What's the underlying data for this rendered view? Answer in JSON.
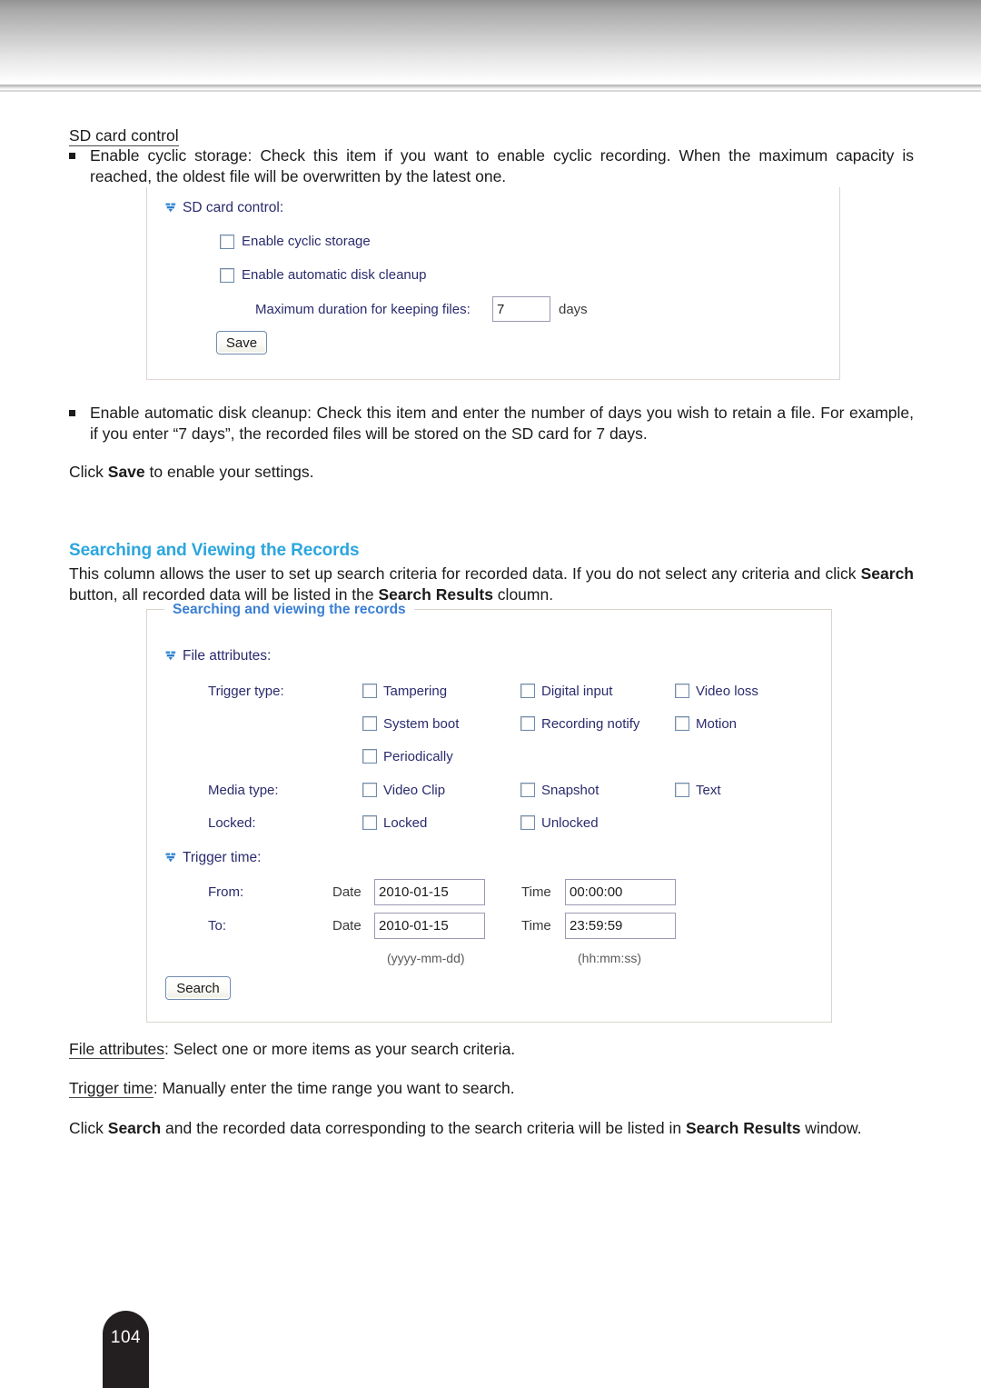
{
  "page": {
    "number": "104"
  },
  "sd_section": {
    "heading": "SD card control",
    "bullet1": "Enable cyclic storage: Check this item if you want to enable cyclic recording. When the maximum capacity is reached, the oldest file will be overwritten by the latest one.",
    "bullet2": "Enable automatic disk cleanup: Check this item and enter the number of days you wish to retain a file. For example, if you enter “7 days”, the recorded files will be stored on the SD card for 7 days.",
    "click_save_prefix": "Click ",
    "click_save_bold": "Save",
    "click_save_suffix": " to enable your settings."
  },
  "sd_panel": {
    "group_label": "SD card control:",
    "chevron_icon": "double-chevron-down-icon",
    "checkbox_cyclic": {
      "label": "Enable cyclic storage",
      "checked": false
    },
    "checkbox_cleanup": {
      "label": "Enable automatic disk cleanup",
      "checked": false
    },
    "max_duration_label": "Maximum duration for keeping files:",
    "max_duration_value": "7",
    "max_duration_unit": "days",
    "save_button": "Save"
  },
  "search_section": {
    "heading": "Searching and Viewing the Records",
    "intro_1": "This column allows the user to set up search criteria for recorded data. If you do not select any criteria ",
    "intro_2": "and click ",
    "intro_bold_1": "Search",
    "intro_3": " button, all recorded data will be listed in the ",
    "intro_bold_2": "Search Results",
    "intro_4": " cloumn."
  },
  "search_panel": {
    "legend": "Searching and viewing the records",
    "chevron_icon": "double-chevron-down-icon",
    "file_attributes_label": "File attributes:",
    "trigger_type_label": "Trigger type:",
    "trigger_type_options": [
      {
        "label": "Tampering",
        "checked": false
      },
      {
        "label": "Digital input",
        "checked": false
      },
      {
        "label": "Video loss",
        "checked": false
      },
      {
        "label": "System boot",
        "checked": false
      },
      {
        "label": "Recording notify",
        "checked": false
      },
      {
        "label": "Motion",
        "checked": false
      },
      {
        "label": "Periodically",
        "checked": false
      }
    ],
    "media_type_label": "Media type:",
    "media_type_options": [
      {
        "label": "Video Clip",
        "checked": false
      },
      {
        "label": "Snapshot",
        "checked": false
      },
      {
        "label": "Text",
        "checked": false
      }
    ],
    "locked_label": "Locked:",
    "locked_options": [
      {
        "label": "Locked",
        "checked": false
      },
      {
        "label": "Unlocked",
        "checked": false
      }
    ],
    "trigger_time_label": "Trigger time:",
    "from_label": "From:",
    "to_label": "To:",
    "date_label": "Date",
    "time_label": "Time",
    "from_date": "2010-01-15",
    "from_time": "00:00:00",
    "to_date": "2010-01-15",
    "to_time": "23:59:59",
    "date_format_hint": "(yyyy-mm-dd)",
    "time_format_hint": "(hh:mm:ss)",
    "search_button": "Search"
  },
  "footer_notes": {
    "file_attributes_term": "File attributes",
    "file_attributes_desc": ": Select one or more items as your search criteria.",
    "trigger_time_term": "Trigger time",
    "trigger_time_desc": ": Manually enter the time range you want to search.",
    "final_1": "Click ",
    "final_bold_1": "Search",
    "final_2": " and the recorded data corresponding to the search criteria will be listed in ",
    "final_bold_2": "Search Results",
    "final_3": " window."
  },
  "colors": {
    "heading_blue": "#2ba6de",
    "legend_blue": "#3a7fd5",
    "label_navy": "#2b2b6e",
    "chevron_blue": "#2f7fd0",
    "page_tab": "#231f20"
  }
}
